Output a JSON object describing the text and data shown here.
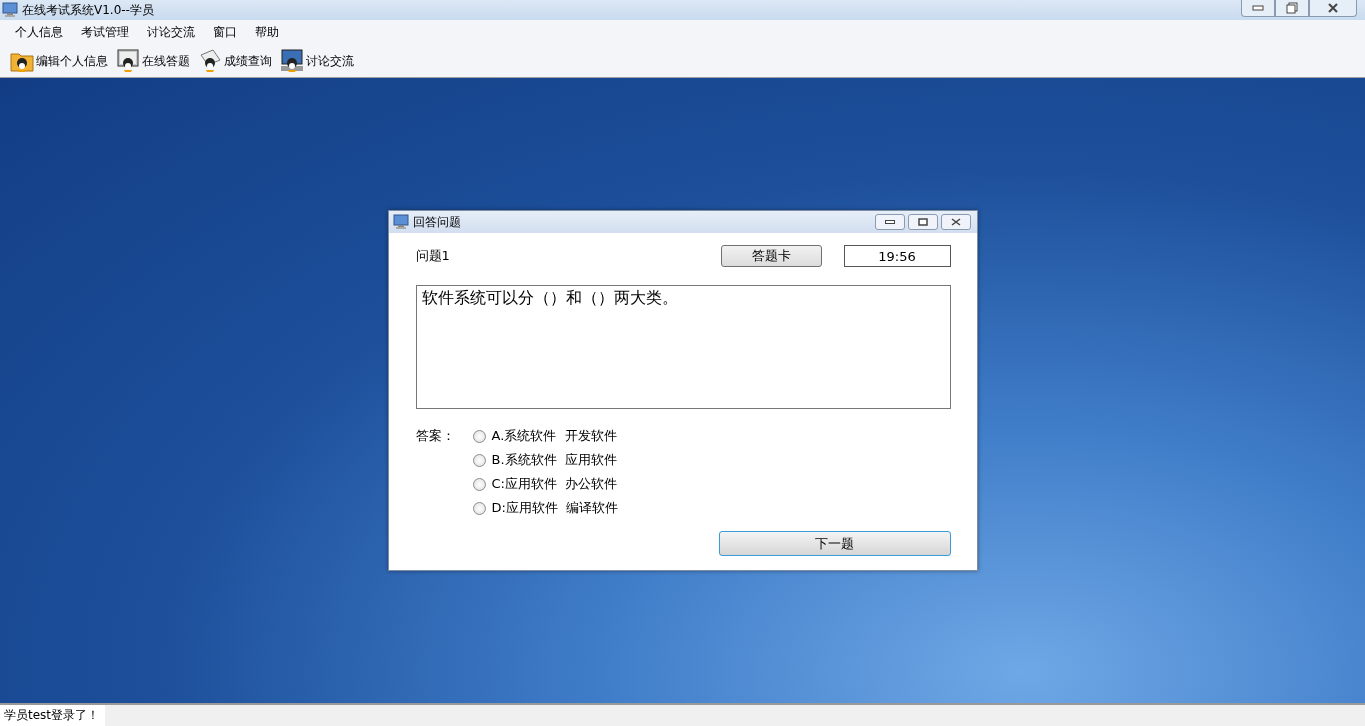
{
  "window": {
    "title": "在线考试系统V1.0--学员"
  },
  "menu": [
    "个人信息",
    "考试管理",
    "讨论交流",
    "窗口",
    "帮助"
  ],
  "toolbar": [
    {
      "label": "编辑个人信息",
      "kind": "folder"
    },
    {
      "label": "在线答题",
      "kind": "monitor"
    },
    {
      "label": "成绩查询",
      "kind": "paper"
    },
    {
      "label": "讨论交流",
      "kind": "chat"
    }
  ],
  "dialog": {
    "title": "回答问题",
    "question_label": "问题1",
    "card_button": "答题卡",
    "timer": "19:56",
    "question_text": "软件系统可以分（）和（）两大类。",
    "answer_label": "答案：",
    "options": [
      {
        "label": "A.系统软件  开发软件",
        "selected": false
      },
      {
        "label": "B.系统软件  应用软件",
        "selected": false
      },
      {
        "label": "C:应用软件  办公软件",
        "selected": false
      },
      {
        "label": "D:应用软件  编译软件",
        "selected": false
      }
    ],
    "next_button": "下一题"
  },
  "status_bar": "学员test登录了！"
}
